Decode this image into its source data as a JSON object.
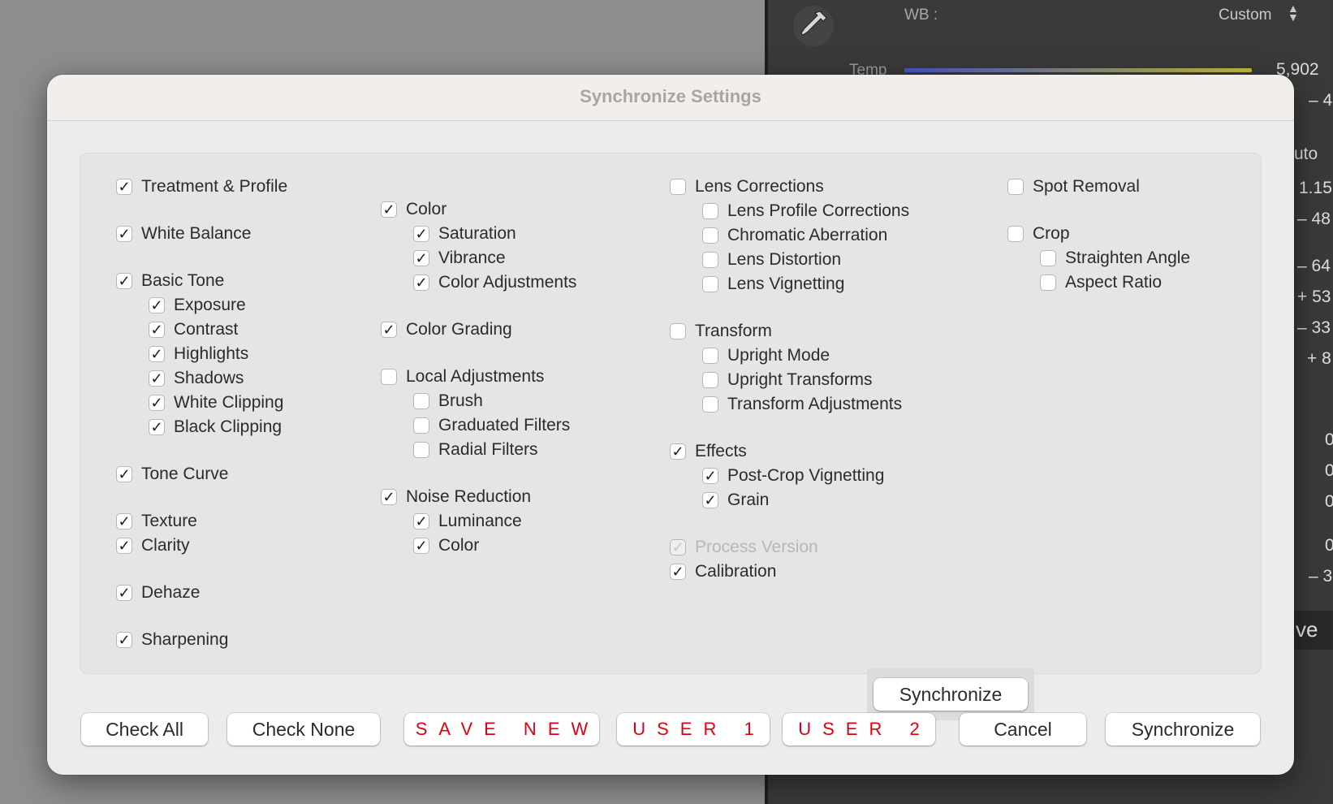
{
  "background": {
    "wb_label": "WB :",
    "wb_value": "Custom",
    "temp_label": "Temp",
    "temp_value": "5,902",
    "numbers": [
      "– 4",
      "1.15",
      "– 48",
      "– 64",
      "+ 53",
      "– 33",
      "+ 8",
      "0",
      "0",
      "0",
      "0",
      "– 3"
    ],
    "auto_text": "uto",
    "save_text": "ve"
  },
  "dialog": {
    "title": "Synchronize Settings",
    "columns": [
      {
        "items": [
          {
            "label": "Treatment & Profile",
            "checked": true
          },
          {
            "label": "White Balance",
            "checked": true
          },
          {
            "label": "Basic Tone",
            "checked": true
          },
          {
            "label": "Exposure",
            "checked": true
          },
          {
            "label": "Contrast",
            "checked": true
          },
          {
            "label": "Highlights",
            "checked": true
          },
          {
            "label": "Shadows",
            "checked": true
          },
          {
            "label": "White Clipping",
            "checked": true
          },
          {
            "label": "Black Clipping",
            "checked": true
          },
          {
            "label": "Tone Curve",
            "checked": true
          },
          {
            "label": "Texture",
            "checked": true
          },
          {
            "label": "Clarity",
            "checked": true
          },
          {
            "label": "Dehaze",
            "checked": true
          },
          {
            "label": "Sharpening",
            "checked": true
          }
        ]
      },
      {
        "items": [
          {
            "label": "Color",
            "checked": true
          },
          {
            "label": "Saturation",
            "checked": true
          },
          {
            "label": "Vibrance",
            "checked": true
          },
          {
            "label": "Color Adjustments",
            "checked": true
          },
          {
            "label": "Color Grading",
            "checked": true
          },
          {
            "label": "Local Adjustments",
            "checked": false
          },
          {
            "label": "Brush",
            "checked": false
          },
          {
            "label": "Graduated Filters",
            "checked": false
          },
          {
            "label": "Radial Filters",
            "checked": false
          },
          {
            "label": "Noise Reduction",
            "checked": true
          },
          {
            "label": "Luminance",
            "checked": true
          },
          {
            "label": "Color",
            "checked": true
          }
        ]
      },
      {
        "items": [
          {
            "label": "Lens Corrections",
            "checked": false
          },
          {
            "label": "Lens Profile Corrections",
            "checked": false
          },
          {
            "label": "Chromatic Aberration",
            "checked": false
          },
          {
            "label": "Lens Distortion",
            "checked": false
          },
          {
            "label": "Lens Vignetting",
            "checked": false
          },
          {
            "label": "Transform",
            "checked": false
          },
          {
            "label": "Upright Mode",
            "checked": false
          },
          {
            "label": "Upright Transforms",
            "checked": false
          },
          {
            "label": "Transform Adjustments",
            "checked": false
          },
          {
            "label": "Effects",
            "checked": true
          },
          {
            "label": "Post-Crop Vignetting",
            "checked": true
          },
          {
            "label": "Grain",
            "checked": true
          },
          {
            "label": "Process Version",
            "checked": true,
            "disabled": true
          },
          {
            "label": "Calibration",
            "checked": true
          }
        ]
      },
      {
        "items": [
          {
            "label": "Spot Removal",
            "checked": false
          },
          {
            "label": "Crop",
            "checked": false
          },
          {
            "label": "Straighten Angle",
            "checked": false
          },
          {
            "label": "Aspect Ratio",
            "checked": false
          }
        ]
      }
    ],
    "inner_button": "Synchronize",
    "buttons": {
      "check_all": "Check All",
      "check_none": "Check None",
      "save_new": "SAVE NEW",
      "user_1": "USER 1",
      "user_2": "USER 2",
      "cancel": "Cancel",
      "synchronize": "Synchronize"
    },
    "accent_red": "#e00010"
  }
}
